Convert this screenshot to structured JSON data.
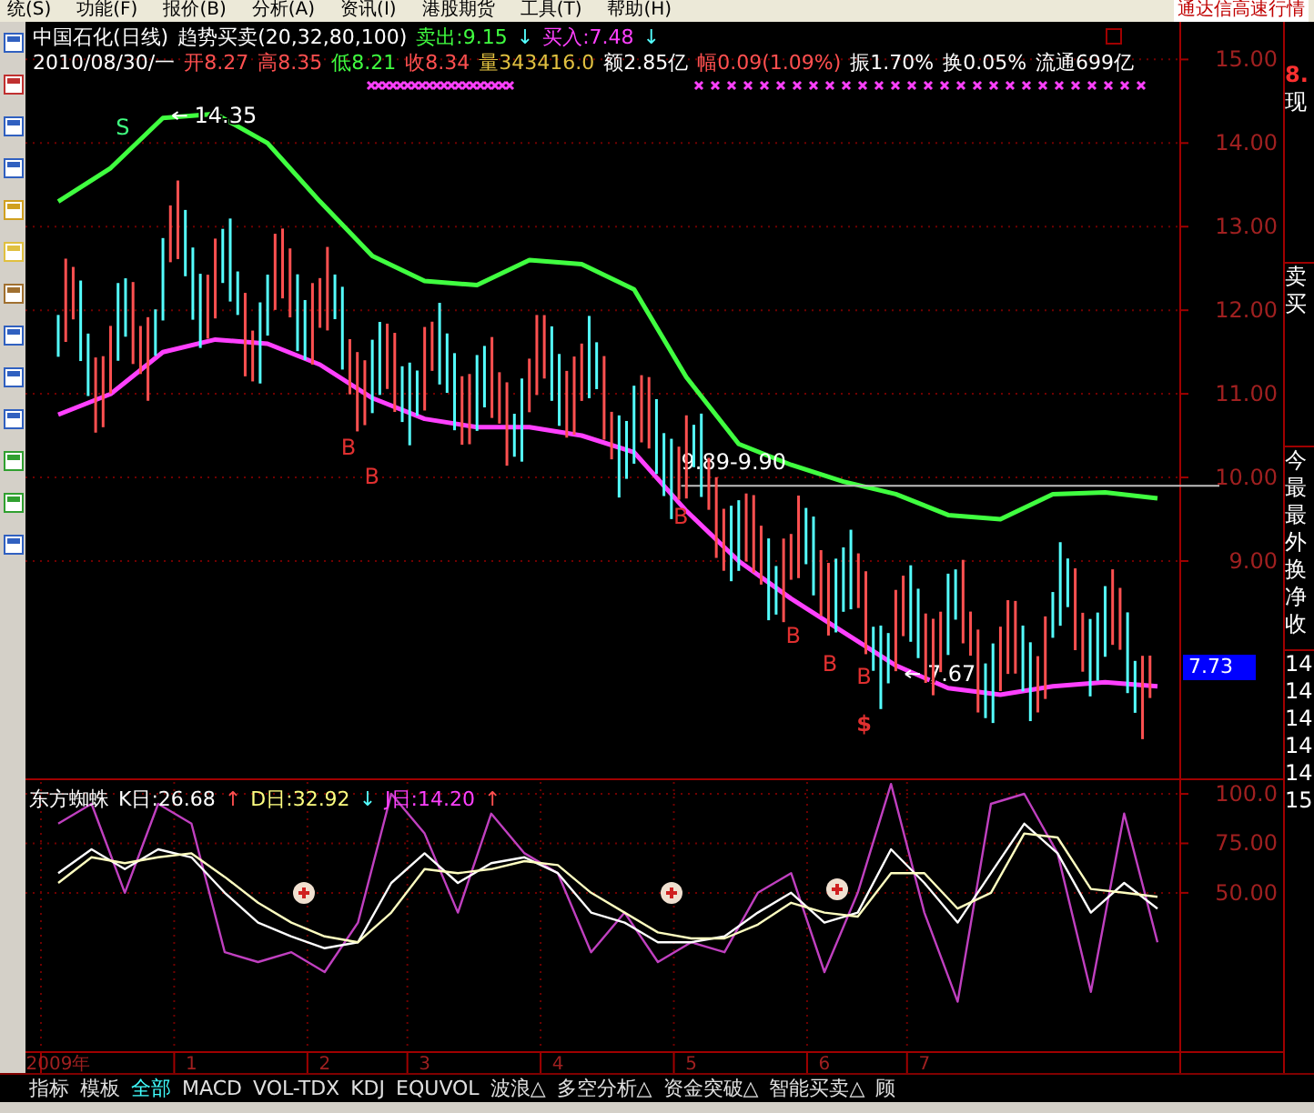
{
  "menu_bar": {
    "items": [
      "统(S)",
      "功能(F)",
      "报价(B)",
      "分析(A)",
      "资讯(I)",
      "港股期货",
      "工具(T)",
      "帮助(H)"
    ],
    "brand": "通达信高速行情"
  },
  "main": {
    "header": {
      "line_1": [
        {
          "text": "中国石化(日线)",
          "color": "#ffffff"
        },
        {
          "text": "趋势买卖(20,32,80,100)",
          "color": "#ffffff"
        },
        {
          "text": "卖出:9.15",
          "color": "#40ff40"
        },
        {
          "text": "↓",
          "color": "#54ffff"
        },
        {
          "text": "买入:7.48",
          "color": "#ff40ff"
        },
        {
          "text": "↓",
          "color": "#54ffff"
        }
      ],
      "line_2": [
        {
          "text": "2010/08/30/一",
          "color": "#ffffff"
        },
        {
          "text": "开8.27",
          "color": "#ff5050"
        },
        {
          "text": "高8.35",
          "color": "#ff5050"
        },
        {
          "text": "低8.21",
          "color": "#40ff40"
        },
        {
          "text": "收8.34",
          "color": "#ff5050"
        },
        {
          "text": "量343416.0",
          "color": "#e0c040"
        },
        {
          "text": "额2.85亿",
          "color": "#ffffff"
        },
        {
          "text": "幅0.09(1.09%)",
          "color": "#ff5050"
        },
        {
          "text": "振1.70%",
          "color": "#ffffff"
        },
        {
          "text": "换0.05%",
          "color": "#ffffff"
        },
        {
          "text": "流通699亿",
          "color": "#ffffff"
        }
      ]
    },
    "current_price": "7.73",
    "chart_data": {
      "type": "line",
      "categories": [
        null,
        null,
        null,
        null,
        null,
        null,
        null,
        null,
        null,
        null,
        null,
        null,
        null,
        null,
        null,
        null,
        null,
        null,
        null,
        null,
        null,
        null
      ],
      "series": [
        {
          "color": "#40ff40",
          "values": [
            13.3,
            13.7,
            14.3,
            14.35,
            14.0,
            13.3,
            12.65,
            12.35,
            12.3,
            12.6,
            12.55,
            12.25,
            11.2,
            10.4,
            10.15,
            9.95,
            9.8,
            9.55,
            9.5,
            9.8,
            9.82,
            9.75
          ]
        },
        {
          "color": "#ff40ff",
          "values": [
            10.75,
            11.0,
            11.5,
            11.65,
            11.6,
            11.35,
            10.95,
            10.7,
            10.6,
            10.6,
            10.5,
            10.3,
            9.6,
            9.0,
            8.55,
            8.15,
            7.75,
            7.48,
            7.4,
            7.5,
            7.55,
            7.5
          ]
        }
      ],
      "grid": true,
      "ylim": [
        6.4,
        15.45
      ],
      "yticks": [
        {
          "value": 15,
          "label": "15.00"
        },
        {
          "value": 14,
          "label": "14.00"
        },
        {
          "value": 13,
          "label": "13.00"
        },
        {
          "value": 12,
          "label": "12.00"
        },
        {
          "value": 11,
          "label": "11.00"
        },
        {
          "value": 10,
          "label": "10.00"
        },
        {
          "value": 9,
          "label": "9.00"
        }
      ],
      "annotations": [
        "S",
        "14.35",
        "B",
        "B",
        "9.89-9.90",
        "B",
        "B",
        "B",
        "B",
        "7.67",
        "$"
      ]
    }
  },
  "indicator": {
    "title": [
      {
        "text": "东方蜘蛛",
        "color": "#ffffff"
      },
      {
        "text": "K日:26.68",
        "color": "#ffffff"
      },
      {
        "text": "↑",
        "color": "#ff5050"
      },
      {
        "text": "D日:32.92",
        "color": "#ffff80"
      },
      {
        "text": "↓",
        "color": "#54ffff"
      },
      {
        "text": "J日:14.20",
        "color": "#ff40ff"
      },
      {
        "text": "↑",
        "color": "#ff5050"
      }
    ],
    "chart_data": {
      "type": "line",
      "categories": [
        "2009年",
        null,
        null,
        null,
        "1",
        null,
        null,
        null,
        "2",
        null,
        null,
        "3",
        null,
        null,
        null,
        "4",
        null,
        null,
        null,
        "5",
        null,
        null,
        null,
        "6",
        null,
        null,
        "7",
        null,
        null,
        null,
        null,
        null,
        null,
        null
      ],
      "series": [
        {
          "color": "#c040c0",
          "values": [
            85,
            95,
            50,
            95,
            85,
            20,
            15,
            20,
            10,
            35,
            100,
            80,
            40,
            90,
            70,
            60,
            20,
            40,
            15,
            25,
            20,
            50,
            60,
            10,
            50,
            105,
            40,
            -5,
            95,
            100,
            70,
            0,
            90,
            25
          ]
        },
        {
          "color": "#ffffff",
          "values": [
            60,
            72,
            62,
            72,
            68,
            50,
            35,
            28,
            22,
            25,
            55,
            70,
            55,
            65,
            68,
            60,
            40,
            35,
            25,
            25,
            28,
            40,
            50,
            35,
            40,
            72,
            55,
            35,
            60,
            85,
            70,
            40,
            55,
            42
          ]
        },
        {
          "color": "#ffffc0",
          "values": [
            55,
            68,
            65,
            68,
            70,
            58,
            45,
            35,
            28,
            25,
            40,
            62,
            60,
            62,
            66,
            64,
            50,
            40,
            30,
            27,
            27,
            34,
            45,
            40,
            38,
            60,
            60,
            42,
            50,
            80,
            78,
            52,
            50,
            48
          ]
        }
      ],
      "grid": true,
      "ylim": [
        -30,
        106
      ],
      "yticks": [
        {
          "value": 100,
          "label": "100.0"
        },
        {
          "value": 75,
          "label": "75.00"
        },
        {
          "value": 50,
          "label": "50.00"
        }
      ]
    }
  },
  "right_panel": {
    "sections": [
      [
        "8.",
        "现"
      ],
      [
        "卖",
        "买"
      ],
      [
        "今",
        "最",
        "最",
        "外",
        "换",
        "净",
        "收"
      ],
      [
        "14",
        "14",
        "14",
        "14",
        "14",
        "15"
      ]
    ]
  },
  "tabs": [
    {
      "label": "指标",
      "selected": false
    },
    {
      "label": "模板",
      "selected": false
    },
    {
      "label": "全部",
      "selected": true
    },
    {
      "label": "MACD",
      "selected": false
    },
    {
      "label": "VOL-TDX",
      "selected": false
    },
    {
      "label": "KDJ",
      "selected": false
    },
    {
      "label": "EQUVOL",
      "selected": false
    },
    {
      "label": "波浪△",
      "selected": false
    },
    {
      "label": "多空分析△",
      "selected": false
    },
    {
      "label": "资金突破△",
      "selected": false
    },
    {
      "label": "智能买卖△",
      "selected": false
    },
    {
      "label": "顾",
      "selected": false
    }
  ]
}
